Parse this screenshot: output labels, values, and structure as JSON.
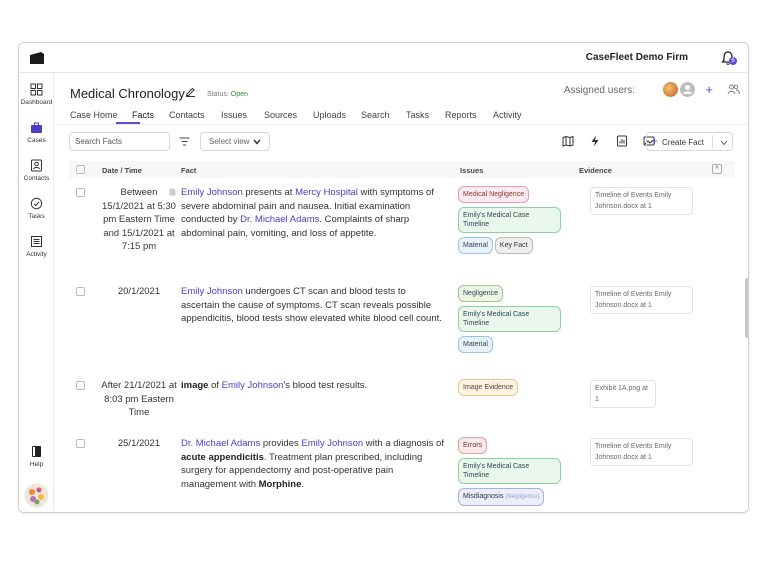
{
  "app": {
    "firm_name": "CaseFleet Demo Firm",
    "notification_count": "6"
  },
  "sidebar": {
    "items": [
      {
        "label": "Dashboard",
        "icon": "dashboard-icon"
      },
      {
        "label": "Cases",
        "icon": "briefcase-icon"
      },
      {
        "label": "Contacts",
        "icon": "contact-card-icon"
      },
      {
        "label": "Tasks",
        "icon": "task-check-icon"
      },
      {
        "label": "Activity",
        "icon": "activity-list-icon"
      },
      {
        "label": "Help",
        "icon": "help-book-icon"
      }
    ]
  },
  "header": {
    "title": "Medical Chronology",
    "status_label": "Status:",
    "status_value": "Open",
    "assigned_label": "Assigned users:"
  },
  "tabs": [
    {
      "label": "Case Home"
    },
    {
      "label": "Facts"
    },
    {
      "label": "Contacts"
    },
    {
      "label": "Issues"
    },
    {
      "label": "Sources"
    },
    {
      "label": "Uploads"
    },
    {
      "label": "Search"
    },
    {
      "label": "Tasks"
    },
    {
      "label": "Reports"
    },
    {
      "label": "Activity"
    }
  ],
  "active_tab": "Facts",
  "toolbar": {
    "search_placeholder": "Search Facts",
    "select_view_label": "Select view",
    "create_fact_label": "Create Fact"
  },
  "table": {
    "headers": {
      "date": "Date / Time",
      "fact": "Fact",
      "issues": "Issues",
      "evidence": "Evidence"
    }
  },
  "rows": [
    {
      "date": "Between 15/1/2021 at 5:30 pm Eastern Time and 15/1/2021 at 7:15 pm",
      "fact": {
        "p1": "Emily Johnson",
        "t1": " presents at ",
        "p2": "Mercy Hospital",
        "t2": " with symptoms of severe abdominal pain and nausea. Initial examination conducted by ",
        "p3": "Dr. Michael Adams",
        "t3": ". Complaints of sharp abdominal pain, vomiting, and loss of appetite."
      },
      "issues": [
        "Medical Negligence",
        "Emily's Medical Case Timeline",
        "Material",
        "Key Fact"
      ],
      "evidence": "Timeline of Events Emily Johnson.docx at 1"
    },
    {
      "date": "20/1/2021",
      "fact": {
        "p1": "Emily Johnson",
        "t1": " undergoes CT scan and blood tests to ascertain the cause of symptoms. CT scan reveals possible appendicitis, blood tests show elevated white blood cell count."
      },
      "issues": [
        "Negligence",
        "Emily's Medical Case Timeline",
        "Material"
      ],
      "evidence": "Timeline of Events Emily Johnson.docx at 1"
    },
    {
      "date": "After 21/1/2021 at 8:03 pm Eastern Time",
      "fact": {
        "b1": "image",
        "t1": " of ",
        "p1": "Emily Johnson",
        "t2": "'s blood test results."
      },
      "issues": [
        "Image Evidence"
      ],
      "evidence": "Exhibit 1A.png at 1"
    },
    {
      "date": "25/1/2021",
      "fact": {
        "p1": "Dr. Michael Adams",
        "t1": " provides ",
        "p2": "Emily Johnson",
        "t2": " with a diagnosis of ",
        "b1": "acute appendicitis",
        "t3": ". Treatment plan prescribed, including surgery for appendectomy and post-operative pain management with ",
        "b2": "Morphine",
        "t4": "."
      },
      "issues": [
        "Errors",
        "Emily's Medical Case Timeline",
        "Misdiagnosis",
        "(Negligence)"
      ],
      "evidence": "Timeline of Events Emily Johnson.docx at 1"
    }
  ]
}
